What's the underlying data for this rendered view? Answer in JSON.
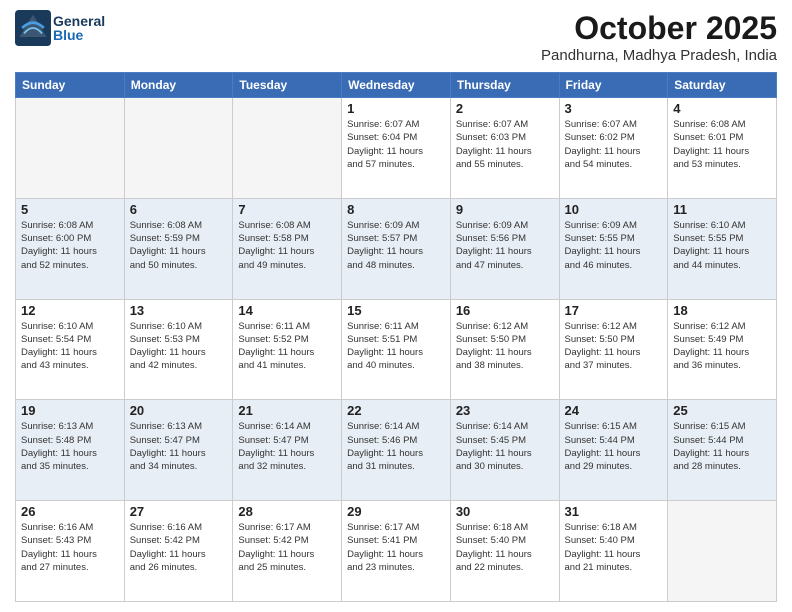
{
  "header": {
    "logo_general": "General",
    "logo_blue": "Blue",
    "month_title": "October 2025",
    "location": "Pandhurna, Madhya Pradesh, India"
  },
  "days_of_week": [
    "Sunday",
    "Monday",
    "Tuesday",
    "Wednesday",
    "Thursday",
    "Friday",
    "Saturday"
  ],
  "weeks": [
    [
      {
        "day": "",
        "info": ""
      },
      {
        "day": "",
        "info": ""
      },
      {
        "day": "",
        "info": ""
      },
      {
        "day": "1",
        "info": "Sunrise: 6:07 AM\nSunset: 6:04 PM\nDaylight: 11 hours\nand 57 minutes."
      },
      {
        "day": "2",
        "info": "Sunrise: 6:07 AM\nSunset: 6:03 PM\nDaylight: 11 hours\nand 55 minutes."
      },
      {
        "day": "3",
        "info": "Sunrise: 6:07 AM\nSunset: 6:02 PM\nDaylight: 11 hours\nand 54 minutes."
      },
      {
        "day": "4",
        "info": "Sunrise: 6:08 AM\nSunset: 6:01 PM\nDaylight: 11 hours\nand 53 minutes."
      }
    ],
    [
      {
        "day": "5",
        "info": "Sunrise: 6:08 AM\nSunset: 6:00 PM\nDaylight: 11 hours\nand 52 minutes."
      },
      {
        "day": "6",
        "info": "Sunrise: 6:08 AM\nSunset: 5:59 PM\nDaylight: 11 hours\nand 50 minutes."
      },
      {
        "day": "7",
        "info": "Sunrise: 6:08 AM\nSunset: 5:58 PM\nDaylight: 11 hours\nand 49 minutes."
      },
      {
        "day": "8",
        "info": "Sunrise: 6:09 AM\nSunset: 5:57 PM\nDaylight: 11 hours\nand 48 minutes."
      },
      {
        "day": "9",
        "info": "Sunrise: 6:09 AM\nSunset: 5:56 PM\nDaylight: 11 hours\nand 47 minutes."
      },
      {
        "day": "10",
        "info": "Sunrise: 6:09 AM\nSunset: 5:55 PM\nDaylight: 11 hours\nand 46 minutes."
      },
      {
        "day": "11",
        "info": "Sunrise: 6:10 AM\nSunset: 5:55 PM\nDaylight: 11 hours\nand 44 minutes."
      }
    ],
    [
      {
        "day": "12",
        "info": "Sunrise: 6:10 AM\nSunset: 5:54 PM\nDaylight: 11 hours\nand 43 minutes."
      },
      {
        "day": "13",
        "info": "Sunrise: 6:10 AM\nSunset: 5:53 PM\nDaylight: 11 hours\nand 42 minutes."
      },
      {
        "day": "14",
        "info": "Sunrise: 6:11 AM\nSunset: 5:52 PM\nDaylight: 11 hours\nand 41 minutes."
      },
      {
        "day": "15",
        "info": "Sunrise: 6:11 AM\nSunset: 5:51 PM\nDaylight: 11 hours\nand 40 minutes."
      },
      {
        "day": "16",
        "info": "Sunrise: 6:12 AM\nSunset: 5:50 PM\nDaylight: 11 hours\nand 38 minutes."
      },
      {
        "day": "17",
        "info": "Sunrise: 6:12 AM\nSunset: 5:50 PM\nDaylight: 11 hours\nand 37 minutes."
      },
      {
        "day": "18",
        "info": "Sunrise: 6:12 AM\nSunset: 5:49 PM\nDaylight: 11 hours\nand 36 minutes."
      }
    ],
    [
      {
        "day": "19",
        "info": "Sunrise: 6:13 AM\nSunset: 5:48 PM\nDaylight: 11 hours\nand 35 minutes."
      },
      {
        "day": "20",
        "info": "Sunrise: 6:13 AM\nSunset: 5:47 PM\nDaylight: 11 hours\nand 34 minutes."
      },
      {
        "day": "21",
        "info": "Sunrise: 6:14 AM\nSunset: 5:47 PM\nDaylight: 11 hours\nand 32 minutes."
      },
      {
        "day": "22",
        "info": "Sunrise: 6:14 AM\nSunset: 5:46 PM\nDaylight: 11 hours\nand 31 minutes."
      },
      {
        "day": "23",
        "info": "Sunrise: 6:14 AM\nSunset: 5:45 PM\nDaylight: 11 hours\nand 30 minutes."
      },
      {
        "day": "24",
        "info": "Sunrise: 6:15 AM\nSunset: 5:44 PM\nDaylight: 11 hours\nand 29 minutes."
      },
      {
        "day": "25",
        "info": "Sunrise: 6:15 AM\nSunset: 5:44 PM\nDaylight: 11 hours\nand 28 minutes."
      }
    ],
    [
      {
        "day": "26",
        "info": "Sunrise: 6:16 AM\nSunset: 5:43 PM\nDaylight: 11 hours\nand 27 minutes."
      },
      {
        "day": "27",
        "info": "Sunrise: 6:16 AM\nSunset: 5:42 PM\nDaylight: 11 hours\nand 26 minutes."
      },
      {
        "day": "28",
        "info": "Sunrise: 6:17 AM\nSunset: 5:42 PM\nDaylight: 11 hours\nand 25 minutes."
      },
      {
        "day": "29",
        "info": "Sunrise: 6:17 AM\nSunset: 5:41 PM\nDaylight: 11 hours\nand 23 minutes."
      },
      {
        "day": "30",
        "info": "Sunrise: 6:18 AM\nSunset: 5:40 PM\nDaylight: 11 hours\nand 22 minutes."
      },
      {
        "day": "31",
        "info": "Sunrise: 6:18 AM\nSunset: 5:40 PM\nDaylight: 11 hours\nand 21 minutes."
      },
      {
        "day": "",
        "info": ""
      }
    ]
  ]
}
